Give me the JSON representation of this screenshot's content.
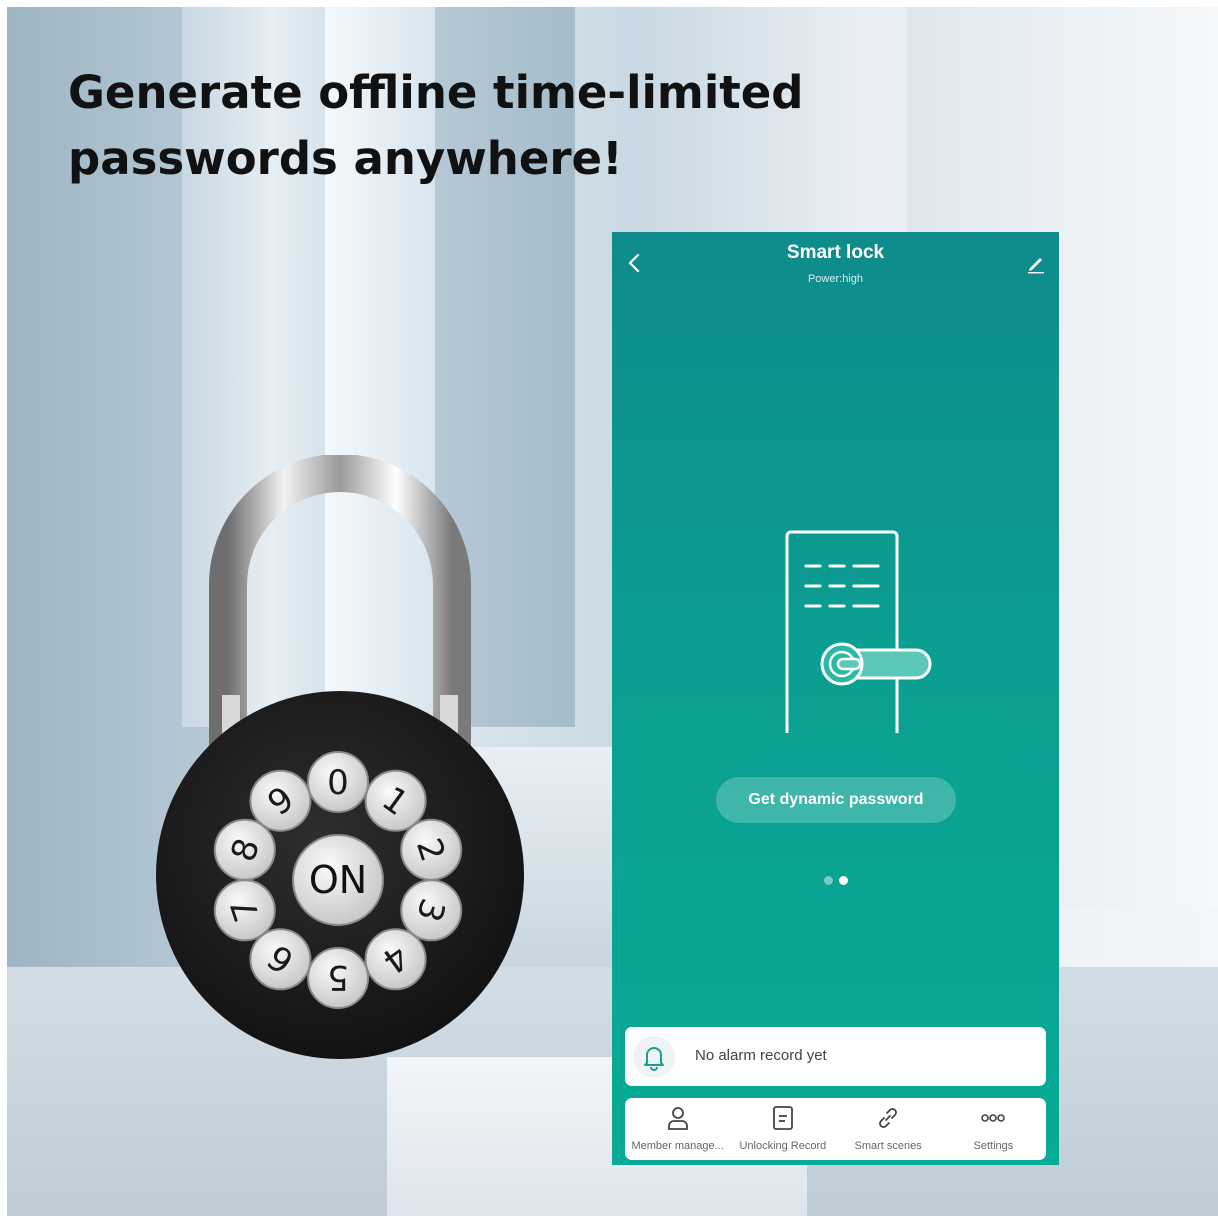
{
  "headline": "Generate offline time-limited\npasswords anywhere!",
  "lock": {
    "keys": [
      "0",
      "1",
      "2",
      "3",
      "4",
      "5",
      "6",
      "7",
      "8",
      "9"
    ],
    "center_label": "ON"
  },
  "app": {
    "title": "Smart lock",
    "subtitle": "Power:high",
    "dynamic_password_label": "Get dynamic password",
    "page_indicator": {
      "count": 2,
      "active": 2
    },
    "alarm_text": "No alarm record yet",
    "tabs": [
      {
        "label": "Member manage...",
        "icon": "person-icon"
      },
      {
        "label": "Unlocking Record",
        "icon": "document-icon"
      },
      {
        "label": "Smart scenes",
        "icon": "link-icon"
      },
      {
        "label": "Settings",
        "icon": "more-dots-icon"
      }
    ]
  },
  "colors": {
    "app_top": "#0f8b8c",
    "app_bottom": "#08ab95",
    "headline": "#111111",
    "lock_body": "#1c1c1c",
    "keys": "#e4e4e4"
  }
}
